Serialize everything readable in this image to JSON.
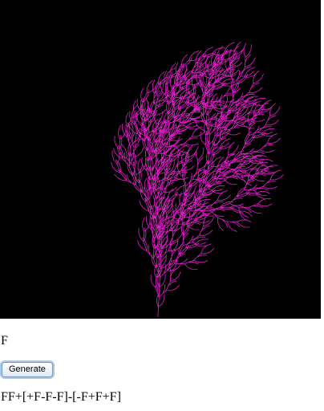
{
  "canvas": {
    "background": "#000000",
    "stroke_color": "#e01fc8"
  },
  "axiom": "F",
  "generate_button": {
    "label": "Generate"
  },
  "rule": "FF+[+F-F-F]-[-F+F+F]"
}
